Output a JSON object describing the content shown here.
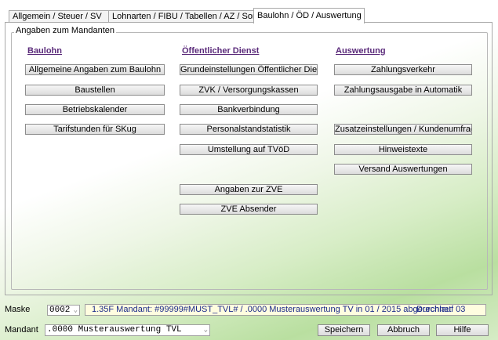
{
  "tabs": [
    {
      "label": "Allgemein / Steuer / SV"
    },
    {
      "label": "Lohnarten / FIBU / Tabellen / AZ / Sonstige"
    },
    {
      "label": "Baulohn / ÖD / Auswertung"
    }
  ],
  "group": {
    "title": "Angaben zum Mandanten"
  },
  "columns": {
    "baulohn": {
      "heading": "Baulohn",
      "buttons": [
        "Allgemeine Angaben zum Baulohn",
        "Baustellen",
        "Betriebskalender",
        "Tarifstunden für SKug"
      ]
    },
    "oed": {
      "heading": "Öffentlicher Dienst",
      "buttons": [
        "Grundeinstellungen Öffentlicher Dienst",
        "ZVK / Versorgungskassen",
        "Bankverbindung",
        "Personalstandstatistik",
        "Umstellung auf TVöD",
        "Angaben zur ZVE",
        "ZVE Absender"
      ]
    },
    "auswertung": {
      "heading": "Auswertung",
      "buttons": [
        "Zahlungsverkehr",
        "Zahlungsausgabe in Automatik",
        "Zusatzeinstellungen / Kundenumfrage",
        "Hinweistexte",
        "Versand Auswertungen"
      ]
    }
  },
  "footer": {
    "maske_label": "Maske",
    "maske_value": "0002",
    "status_text": "1.35F Mandant: #99999#MUST_TVL# / .0000 Musterauswertung TV in 01 / 2015 abgerechnet",
    "status_run": "Durchlauf 03",
    "mandant_label": "Mandant",
    "mandant_value": ".0000 Musterauswertung TVL",
    "save_label": "Speichern",
    "cancel_label": "Abbruch",
    "help_label": "Hilfe"
  }
}
